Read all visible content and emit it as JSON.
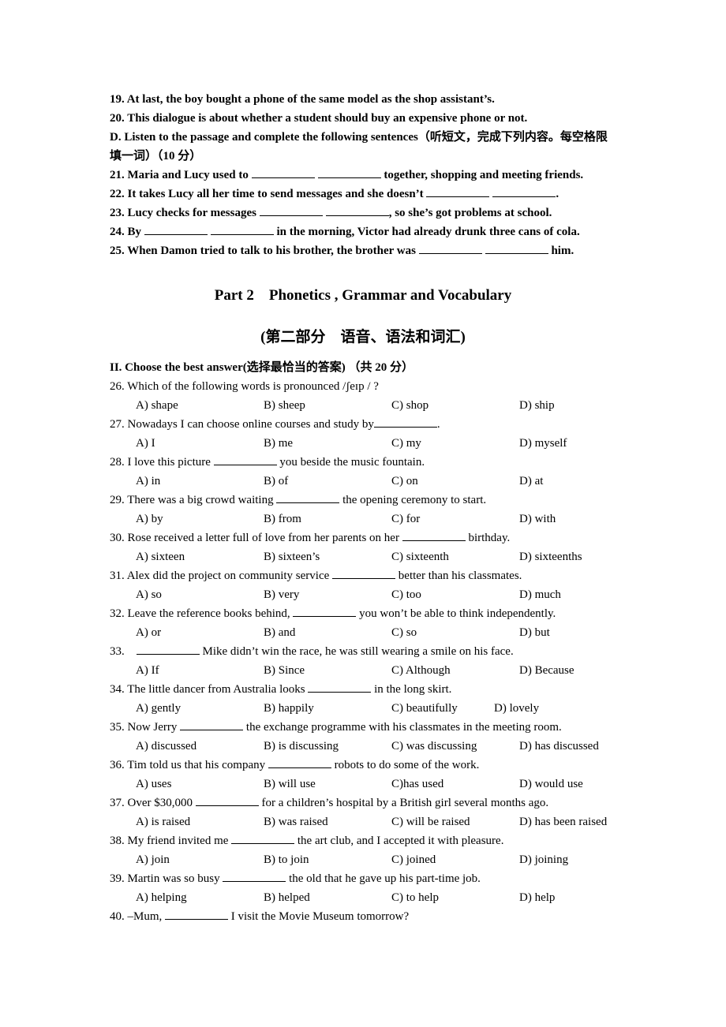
{
  "listening": {
    "items": [
      {
        "n": "19.",
        "text": "At last, the boy bought a phone of the same model as the shop assistant’s."
      },
      {
        "n": "20.",
        "text": "This dialogue is about whether a student should buy an expensive phone or not."
      }
    ],
    "section_d": "D. Listen to the passage and complete the following sentences（听短文，完成下列内容。每空格限填一词）（10 分）",
    "fill": [
      {
        "n": "21.",
        "before": "Maria and Lucy used to",
        "after": "together, shopping and meeting friends."
      },
      {
        "n": "22.",
        "before": "It takes Lucy all her time to send messages and she doesn’t",
        "after": "."
      },
      {
        "n": "23.",
        "before": "Lucy checks for messages",
        "after": ", so she’s got problems at school."
      },
      {
        "n": "24.",
        "before": "By",
        "after": "in the morning, Victor had already drunk three cans of cola."
      },
      {
        "n": "25.",
        "before": "When Damon tried to talk to his brother, the brother was",
        "after": "him."
      }
    ]
  },
  "part2": {
    "title": "Part 2    Phonetics , Grammar and Vocabulary",
    "subtitle": "(第二部分    语音、语法和词汇)",
    "section_heading": "II. Choose the best answer(选择最恰当的答案) （共 20 分）"
  },
  "questions": [
    {
      "n": "26.",
      "before": "Which of the following words is pronounced /ʃeɪp /  ?",
      "after": "",
      "blank": false,
      "options": [
        "A) shape",
        "B) sheep",
        "C) shop",
        "D) ship"
      ]
    },
    {
      "n": "27.",
      "before": "Nowadays I can choose online courses and study by",
      "after": ".",
      "blank": true,
      "options": [
        "A) I",
        "B) me",
        "C) my",
        "D) myself"
      ]
    },
    {
      "n": "28.",
      "before": "I love this picture",
      "after": "you beside the music fountain.",
      "blank": true,
      "options": [
        "A) in",
        "B) of",
        "C) on",
        "D) at"
      ]
    },
    {
      "n": "29.",
      "before": "There was a big crowd waiting",
      "after": "the opening ceremony to start.",
      "blank": true,
      "options": [
        "A) by",
        "B) from",
        "C) for",
        "D) with"
      ]
    },
    {
      "n": "30.",
      "before": "Rose received a letter full of love from her parents on her",
      "after": "birthday.",
      "blank": true,
      "options": [
        "A) sixteen",
        "B) sixteen’s",
        "C) sixteenth",
        "D) sixteenths"
      ]
    },
    {
      "n": "31.",
      "before": "Alex did the project on community service",
      "after": "better than his classmates.",
      "blank": true,
      "options": [
        "A) so",
        "B) very",
        "C) too",
        "D) much"
      ]
    },
    {
      "n": "32.",
      "before": "Leave the reference books behind,",
      "after": "you won’t be able to think independently.",
      "blank": true,
      "options": [
        "A) or",
        "B) and",
        "C) so",
        "D) but"
      ]
    },
    {
      "n": "33.",
      "before": "",
      "after": "Mike didn’t win the race, he was still wearing a smile on his face.",
      "blank": true,
      "options": [
        "A) If",
        "B) Since",
        "C) Although",
        "D) Because"
      ]
    },
    {
      "n": "34.",
      "before": "The little dancer from Australia looks",
      "after": "in the long skirt.",
      "blank": true,
      "options": [
        "A) gently",
        "B) happily",
        "C) beautifully",
        "D) lovely"
      ]
    },
    {
      "n": "35.",
      "before": "Now Jerry",
      "after": "the exchange programme with his classmates in the meeting room.",
      "blank": true,
      "options": [
        "A) discussed",
        "B) is discussing",
        "C) was discussing",
        "D) has discussed"
      ]
    },
    {
      "n": "36.",
      "before": "Tim told us that his company",
      "after": "robots to do some of the work.",
      "blank": true,
      "options": [
        "A) uses",
        "B) will use",
        "C)has used",
        "D) would use"
      ]
    },
    {
      "n": "37.",
      "before": "Over $30,000",
      "after": "for a children’s hospital by a British girl several months ago.",
      "blank": true,
      "options": [
        "A) is raised",
        "B) was raised",
        "C) will be raised",
        "D) has been raised"
      ]
    },
    {
      "n": "38.",
      "before": "My friend invited me",
      "after": "the art club, and I accepted it with pleasure.",
      "blank": true,
      "options": [
        "A) join",
        "B) to join",
        "C) joined",
        "D) joining"
      ]
    },
    {
      "n": "39.",
      "before": "Martin was so busy",
      "after": "the old that he gave up his part-time job.",
      "blank": true,
      "options": [
        "A) helping",
        "B) helped",
        "C) to help",
        "D) help"
      ]
    },
    {
      "n": "40.",
      "before": "–Mum,",
      "after": "I visit the Movie Museum tomorrow?",
      "blank": true,
      "options": []
    }
  ]
}
